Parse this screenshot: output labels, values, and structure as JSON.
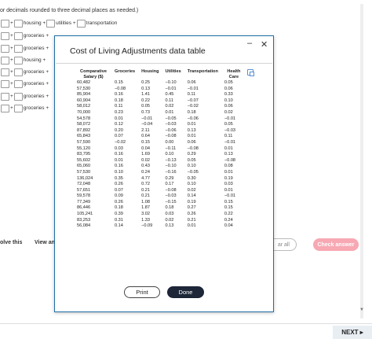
{
  "background": {
    "top_cut_text": "mode",
    "instructions": "or decimals rounded to three decimal places as needed.)",
    "rows": [
      {
        "labels": [
          "+",
          "housing +",
          "utilities +",
          "transportation"
        ]
      },
      {
        "labels": [
          "+",
          "groceries +"
        ]
      },
      {
        "labels": [
          "+",
          "groceries +"
        ]
      },
      {
        "labels": [
          "+",
          "housing +"
        ]
      },
      {
        "labels": [
          "+",
          "groceries +"
        ]
      },
      {
        "labels": [
          "+",
          "groceries +"
        ]
      },
      {
        "labels": [
          "+",
          "groceries +"
        ]
      },
      {
        "labels": [
          "+",
          "groceries +"
        ]
      }
    ],
    "solve_label": "olve this",
    "view_label": "View an",
    "clear_label": "ar all",
    "check_label": "Check answer",
    "next_label": "NEXT ▸"
  },
  "modal": {
    "title": "Cost of Living Adjustments data table",
    "minimize_symbol": "–",
    "close_symbol": "✕",
    "print_label": "Print",
    "done_label": "Done",
    "columns": [
      "Comparative Salary ($)",
      "Groceries",
      "Housing",
      "Utilities",
      "Transportation",
      "Health Care"
    ],
    "rows": [
      [
        "60,482",
        "0.15",
        "0.25",
        "−0.10",
        "0.06",
        "0.05"
      ],
      [
        "57,530",
        "−0.08",
        "0.13",
        "−0.01",
        "−0.01",
        "0.06"
      ],
      [
        "85,904",
        "0.16",
        "1.41",
        "0.45",
        "0.11",
        "0.33"
      ],
      [
        "60,904",
        "0.18",
        "0.22",
        "0.11",
        "−0.07",
        "0.10"
      ],
      [
        "58,012",
        "0.11",
        "0.05",
        "0.02",
        "−0.02",
        "0.06"
      ],
      [
        "70,000",
        "0.23",
        "0.73",
        "0.01",
        "0.18",
        "0.02"
      ],
      [
        "54,578",
        "0.01",
        "−0.01",
        "−0.05",
        "−0.06",
        "−0.01"
      ],
      [
        "58,072",
        "0.12",
        "−0.04",
        "−0.03",
        "0.01",
        "0.05"
      ],
      [
        "87,892",
        "0.20",
        "2.11",
        "−0.06",
        "0.13",
        "−0.03"
      ],
      [
        "65,843",
        "0.07",
        "0.64",
        "−0.08",
        "0.01",
        "0.11"
      ],
      [
        "57,590",
        "−0.02",
        "0.15",
        "0.00",
        "0.06",
        "−0.01"
      ],
      [
        "55,120",
        "0.03",
        "0.04",
        "−0.11",
        "−0.08",
        "0.01"
      ],
      [
        "83,795",
        "0.16",
        "1.69",
        "0.10",
        "0.29",
        "0.13"
      ],
      [
        "55,602",
        "0.01",
        "0.02",
        "−0.13",
        "0.05",
        "−0.08"
      ],
      [
        "65,060",
        "0.16",
        "0.43",
        "−0.10",
        "0.10",
        "0.08"
      ],
      [
        "57,530",
        "0.10",
        "0.24",
        "−0.16",
        "−0.05",
        "0.01"
      ],
      [
        "136,024",
        "0.35",
        "4.77",
        "0.29",
        "0.30",
        "0.19"
      ],
      [
        "72,048",
        "0.26",
        "0.72",
        "0.17",
        "0.10",
        "0.03"
      ],
      [
        "57,651",
        "0.07",
        "0.21",
        "−0.08",
        "0.02",
        "0.01"
      ],
      [
        "59,578",
        "0.09",
        "0.21",
        "−0.03",
        "0.14",
        "−0.01"
      ],
      [
        "77,349",
        "0.26",
        "1.08",
        "−0.15",
        "0.19",
        "0.15"
      ],
      [
        "86,446",
        "0.18",
        "1.87",
        "0.18",
        "0.27",
        "0.15"
      ],
      [
        "105,241",
        "0.39",
        "3.02",
        "0.03",
        "0.26",
        "0.22"
      ],
      [
        "83,253",
        "0.31",
        "1.33",
        "0.02",
        "0.21",
        "0.24"
      ],
      [
        "56,084",
        "0.14",
        "−0.09",
        "0.13",
        "0.01",
        "0.04"
      ]
    ]
  }
}
